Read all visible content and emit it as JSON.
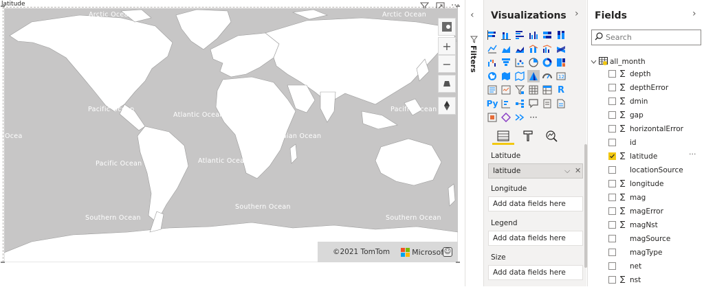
{
  "visual": {
    "title": "latitude",
    "ocean_labels": [
      {
        "key": "arctic_1",
        "text": "Arctic Ocean"
      },
      {
        "key": "arctic_2",
        "text": "Arctic Ocean"
      },
      {
        "key": "pacific_1",
        "text": "Pacific Ocean"
      },
      {
        "key": "atlantic_1",
        "text": "Atlantic Ocean"
      },
      {
        "key": "pacific_2",
        "text": "Pacific Ocean"
      },
      {
        "key": "indian",
        "text": "Indian Ocean"
      },
      {
        "key": "ocean_edge",
        "text": "Ocea"
      },
      {
        "key": "pacific_3",
        "text": "Pacific Ocean"
      },
      {
        "key": "atlantic_2",
        "text": "Atlantic Ocean"
      },
      {
        "key": "pacific_4",
        "text": "Pacific Ocean"
      },
      {
        "key": "southern_1",
        "text": "Southern Ocean"
      },
      {
        "key": "southern_2",
        "text": "Southern Ocean"
      },
      {
        "key": "southern_3",
        "text": "Southern Ocean"
      }
    ],
    "header_icons": [
      "filter-icon",
      "focus-mode-icon",
      "more-options-icon"
    ],
    "map_controls": [
      "compass-icon",
      "zoom-in-icon",
      "zoom-out-icon",
      "tilt-icon",
      "rotate-icon"
    ],
    "copyright": "©2021 TomTom",
    "brand": "Microsoft",
    "colors": {
      "land": "#ffffff",
      "water": "#c7c6c6"
    }
  },
  "filters": {
    "label": "Filters"
  },
  "visualizations": {
    "title": "Visualizations",
    "selected_icon": "filled-map-visual",
    "icons": [
      "stacked-bar-icon",
      "stacked-column-icon",
      "clustered-bar-icon",
      "clustered-column-icon",
      "100-stacked-bar-icon",
      "100-stacked-column-icon",
      "line-chart-icon",
      "area-chart-icon",
      "stacked-area-icon",
      "line-stacked-column-icon",
      "line-clustered-column-icon",
      "ribbon-chart-icon",
      "waterfall-icon",
      "funnel-icon",
      "scatter-icon",
      "pie-icon",
      "donut-icon",
      "treemap-icon",
      "map-icon",
      "filled-map-icon",
      "shape-map-icon",
      "azure-map-icon",
      "gauge-icon",
      "card-icon",
      "multi-row-card-icon",
      "kpi-icon",
      "slicer-icon",
      "table-icon",
      "matrix-icon",
      "r-visual-icon",
      "python-visual-icon",
      "key-influencers-icon",
      "decomposition-tree-icon",
      "qa-icon",
      "smart-narrative-icon",
      "paginated-report-icon",
      "power-apps-icon",
      "power-automate-icon",
      "arcgis-icon",
      "more-visuals-icon"
    ],
    "r_label": "R",
    "py_label": "Py",
    "more_label": "···",
    "tabs": [
      "fields-tab-icon",
      "format-tab-icon",
      "analytics-tab-icon"
    ],
    "wells": [
      {
        "label": "Latitude",
        "value": "latitude",
        "filled": true
      },
      {
        "label": "Longitude",
        "value": "Add data fields here",
        "filled": false
      },
      {
        "label": "Legend",
        "value": "Add data fields here",
        "filled": false
      },
      {
        "label": "Size",
        "value": "Add data fields here",
        "filled": false
      }
    ]
  },
  "fields": {
    "title": "Fields",
    "search_placeholder": "Search",
    "table_name": "all_month",
    "items": [
      {
        "name": "depth",
        "sigma": true,
        "checked": false
      },
      {
        "name": "depthError",
        "sigma": true,
        "checked": false
      },
      {
        "name": "dmin",
        "sigma": true,
        "checked": false
      },
      {
        "name": "gap",
        "sigma": true,
        "checked": false
      },
      {
        "name": "horizontalError",
        "sigma": true,
        "checked": false
      },
      {
        "name": "id",
        "sigma": false,
        "checked": false
      },
      {
        "name": "latitude",
        "sigma": true,
        "checked": true
      },
      {
        "name": "locationSource",
        "sigma": false,
        "checked": false
      },
      {
        "name": "longitude",
        "sigma": true,
        "checked": false
      },
      {
        "name": "mag",
        "sigma": true,
        "checked": false
      },
      {
        "name": "magError",
        "sigma": true,
        "checked": false
      },
      {
        "name": "magNst",
        "sigma": true,
        "checked": false
      },
      {
        "name": "magSource",
        "sigma": false,
        "checked": false
      },
      {
        "name": "magType",
        "sigma": false,
        "checked": false
      },
      {
        "name": "net",
        "sigma": false,
        "checked": false
      },
      {
        "name": "nst",
        "sigma": true,
        "checked": false
      }
    ],
    "sigma_symbol": "∑",
    "more_symbol": "···"
  },
  "accent_color": "#f2c811"
}
